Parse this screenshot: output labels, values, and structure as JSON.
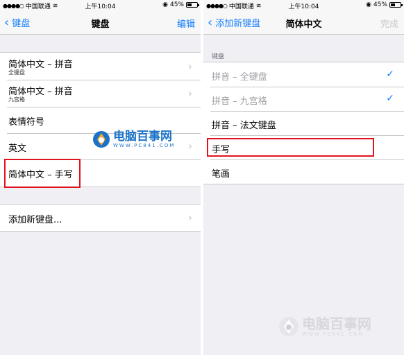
{
  "left": {
    "status": {
      "carrier": "中国联通",
      "time": "上午10:04",
      "battery": "45%",
      "battery_level": 0.45
    },
    "nav": {
      "back": "键盘",
      "title": "键盘",
      "action": "编辑"
    },
    "rows": [
      {
        "label": "简体中文 – 拼音",
        "sub": "全键盘"
      },
      {
        "label": "简体中文 – 拼音",
        "sub": "九宫格"
      },
      {
        "label": "表情符号"
      },
      {
        "label": "英文"
      },
      {
        "label": "简体中文 – 手写"
      }
    ],
    "add_row": {
      "label": "添加新键盘..."
    }
  },
  "right": {
    "status": {
      "carrier": "中国联通",
      "time": "上午10:04",
      "battery": "45%",
      "battery_level": 0.45
    },
    "nav": {
      "back": "添加新键盘",
      "title": "简体中文",
      "action": "完成"
    },
    "section_header": "键盘",
    "rows": [
      {
        "label": "拼音 – 全键盘",
        "checked": true
      },
      {
        "label": "拼音 – 九宫格",
        "checked": true
      },
      {
        "label": "拼音 – 法文键盘"
      },
      {
        "label": "手写"
      },
      {
        "label": "笔画"
      }
    ]
  },
  "watermark": {
    "brand": "电脑百事网",
    "url": "WWW.PC841.COM"
  },
  "colors": {
    "accent": "#147efb",
    "highlight": "#e0141e",
    "brand_blue": "#1a73c8",
    "brand_red": "#e4393c"
  }
}
